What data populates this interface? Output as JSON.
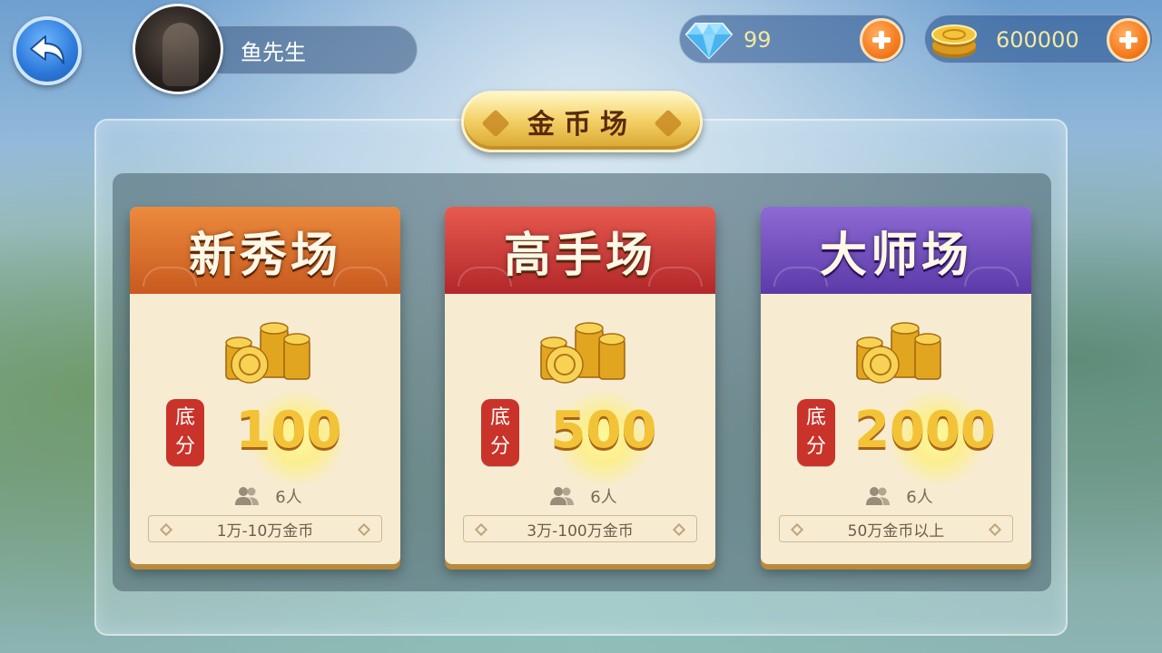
{
  "user": {
    "name": "鱼先生"
  },
  "resources": {
    "gems": {
      "value": "99",
      "icon": "diamond-icon"
    },
    "coins": {
      "value": "600000",
      "icon": "gold-coin-icon"
    }
  },
  "title": "金币场",
  "base_label_top": "底",
  "base_label_bottom": "分",
  "rooms": [
    {
      "name": "新秀场",
      "base": "100",
      "players": "6人",
      "range": "1万-10万金币",
      "color": "#d9702c"
    },
    {
      "name": "高手场",
      "base": "500",
      "players": "6人",
      "range": "3万-100万金币",
      "color": "#c73a35"
    },
    {
      "name": "大师场",
      "base": "2000",
      "players": "6人",
      "range": "50万金币以上",
      "color": "#6e4cc0"
    }
  ]
}
